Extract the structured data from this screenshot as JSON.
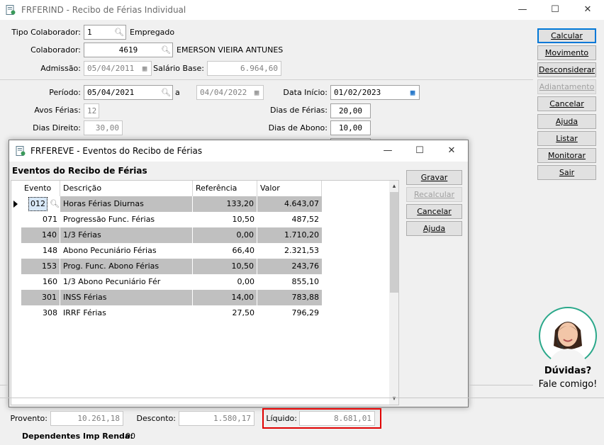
{
  "window": {
    "title": "FRFERIND - Recibo de Férias Individual",
    "icon": "app-document-icon",
    "minimize": "—",
    "maximize": "☐",
    "close": "✕"
  },
  "form": {
    "tipo_colaborador_label": "Tipo Colaborador:",
    "tipo_colaborador_value": "1",
    "tipo_colaborador_desc": "Empregado",
    "colaborador_label": "Colaborador:",
    "colaborador_value": "4619",
    "colaborador_name": "EMERSON VIEIRA ANTUNES",
    "admissao_label": "Admissão:",
    "admissao_value": "05/04/2011",
    "salario_label": "Salário Base:",
    "salario_value": "6.964,60",
    "periodo_label": "Período:",
    "periodo_start": "05/04/2021",
    "periodo_sep": "a",
    "periodo_end": "04/04/2022",
    "data_inicio_label": "Data Início:",
    "data_inicio_value": "01/02/2023",
    "avos_label": "Avos Férias:",
    "avos_value": "12",
    "dias_ferias_label": "Dias de Férias:",
    "dias_ferias_value": "20,00",
    "dias_direito_label": "Dias Direito:",
    "dias_direito_value": "30,00",
    "dias_abono_label": "Dias de Abono:",
    "dias_abono_value": "10,00"
  },
  "buttons": {
    "calcular": "Calcular",
    "movimento": "Movimento",
    "desconsiderar": "Desconsiderar",
    "adiantamento": "Adiantamento",
    "cancelar": "Cancelar",
    "ajuda": "Ajuda",
    "listar": "Listar",
    "monitorar": "Monitorar",
    "sair": "Sair"
  },
  "help": {
    "title": "Dúvidas?",
    "subtitle": "Fale comigo!"
  },
  "child": {
    "title": "FRFEREVE - Eventos do Recibo de Férias",
    "section_title": "Eventos do Recibo de Férias",
    "columns": [
      "Evento",
      "Descrição",
      "Referência",
      "Valor"
    ],
    "rows": [
      {
        "evento": "012",
        "descricao": "Horas Férias Diurnas",
        "referencia": "133,20",
        "valor": "4.643,07"
      },
      {
        "evento": "071",
        "descricao": "Progressão Func. Férias",
        "referencia": "10,50",
        "valor": "487,52"
      },
      {
        "evento": "140",
        "descricao": "1/3 Férias",
        "referencia": "0,00",
        "valor": "1.710,20"
      },
      {
        "evento": "148",
        "descricao": "Abono Pecuniário Férias",
        "referencia": "66,40",
        "valor": "2.321,53"
      },
      {
        "evento": "153",
        "descricao": "Prog. Func. Abono Férias",
        "referencia": "10,50",
        "valor": "243,76"
      },
      {
        "evento": "160",
        "descricao": "1/3 Abono Pecuniário Fér",
        "referencia": "0,00",
        "valor": "855,10"
      },
      {
        "evento": "301",
        "descricao": "INSS Férias",
        "referencia": "14,00",
        "valor": "783,88"
      },
      {
        "evento": "308",
        "descricao": "IRRF Férias",
        "referencia": "27,50",
        "valor": "796,29"
      }
    ],
    "buttons": {
      "gravar": "Gravar",
      "recalcular": "Recalcular",
      "cancelar": "Cancelar",
      "ajuda": "Ajuda"
    }
  },
  "footer": {
    "provento_label": "Provento:",
    "provento_value": "10.261,18",
    "desconto_label": "Desconto:",
    "desconto_value": "1.580,17",
    "liquido_label": "Líquido:",
    "liquido_value": "8.681,01",
    "dependentes_label": "Dependentes Imp Renda:",
    "dependentes_value": "00",
    "highlight_color": "#e00000"
  }
}
